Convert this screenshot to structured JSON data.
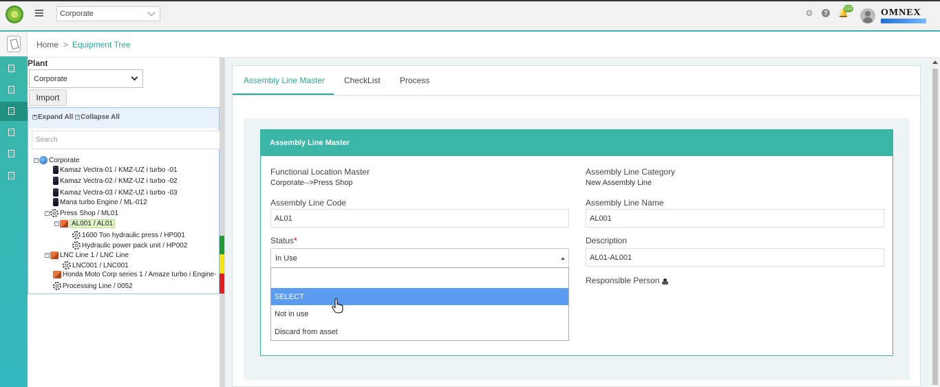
{
  "header": {
    "org_select": "Corporate",
    "notification_count": "112",
    "brand": "OMNEX"
  },
  "breadcrumb": {
    "home": "Home",
    "separator": ">",
    "current": "Equipment Tree"
  },
  "left_panel": {
    "plant_label": "Plant",
    "plant_value": "Corporate",
    "import_label": "Import",
    "expand_all": "Expand All",
    "collapse_all": "Collapse All",
    "search_placeholder": "Search",
    "tree": [
      {
        "label": "Corporate",
        "icon": "globe"
      },
      {
        "label": "Kamaz Vectra-01 / KMZ-UZ i turbo -01",
        "icon": "phone"
      },
      {
        "label": "Kamaz Vectra-02 / KMZ-UZ i turbo -02",
        "icon": "phone"
      },
      {
        "label": "Kamaz Vectra-03 / KMZ-UZ i turbo -03",
        "icon": "phone"
      },
      {
        "label": "Mana turbo Engine / ML-012",
        "icon": "phone"
      },
      {
        "label": "Press Shop / ML01",
        "icon": "gear"
      },
      {
        "label": "AL001 / AL01",
        "icon": "box"
      },
      {
        "label": "1600 Ton hydraulic press / HP001",
        "icon": "gear"
      },
      {
        "label": "Hydraulic power pack unit / HP002",
        "icon": "gear"
      },
      {
        "label": "LNC Line 1 / LNC Line",
        "icon": "box"
      },
      {
        "label": "LNC001 / LNC001",
        "icon": "gear"
      },
      {
        "label": "Honda Moto Corp series 1 / Amaze turbo i Engine-",
        "icon": "box"
      },
      {
        "label": "Processing Line / 0052",
        "icon": "gear"
      }
    ],
    "status_colors": [
      "#1e9e2a",
      "#f5e400",
      "#e81a1a"
    ]
  },
  "tabs": [
    {
      "label": "Assembly Line Master"
    },
    {
      "label": "CheckList"
    },
    {
      "label": "Process"
    }
  ],
  "form": {
    "title": "Assembly Line Master",
    "functional_location_label": "Functional Location Master",
    "functional_location_value": "Corporate-->Press Shop",
    "category_label": "Assembly Line Category",
    "category_value": "New Assembly Line",
    "code_label": "Assembly Line Code",
    "code_value": "AL01",
    "name_label": "Assembly Line Name",
    "name_value": "AL001",
    "status_label": "Status",
    "status_required": "*",
    "status_value": "In Use",
    "status_options": [
      "SELECT",
      "Not in use",
      "Discard from asset"
    ],
    "description_label": "Description",
    "description_value": "AL01-AL001",
    "responsible_label": "Responsible Person"
  },
  "colors": {
    "accent": "#3ab5a6",
    "link": "#2aa795",
    "highlight": "#5b9bf0"
  }
}
